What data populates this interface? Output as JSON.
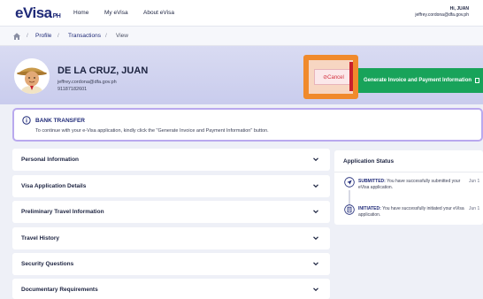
{
  "header": {
    "logo": "eVisa",
    "logo_suffix": "PH",
    "nav": [
      "Home",
      "My eVisa",
      "About eVisa"
    ],
    "greeting": "Hi, JUAN",
    "email": "jeffrey.cordona@dfa.gov.ph"
  },
  "breadcrumb": {
    "items": [
      "Profile",
      "Transactions",
      "View"
    ],
    "separator": "/"
  },
  "profile": {
    "name": "DE LA CRUZ, JUAN",
    "email": "jeffrey.cordona@dfa.gov.ph",
    "phone": "91187182601"
  },
  "actions": {
    "cancel_label": "⊘Cancel",
    "generate_label": "Generate Invoice and Payment Information"
  },
  "alert": {
    "title": "BANK TRANSFER",
    "text": "To continue with your e-Visa application, kindly click the \"Generate Invoice and Payment Information\" button."
  },
  "sections": [
    "Personal Information",
    "Visa Application Details",
    "Preliminary Travel Information",
    "Travel History",
    "Security Questions",
    "Documentary Requirements"
  ],
  "application_status": {
    "title": "Application Status",
    "events": [
      {
        "keyword": "SUBMITTED:",
        "text": "You have successfully submitted your eVisa application.",
        "date": "Jun 1",
        "icon": "send-icon"
      },
      {
        "keyword": "INITIATED:",
        "text": "You have successfully initiated your eVisa application.",
        "date": "Jun 1",
        "icon": "document-icon"
      }
    ]
  },
  "colors": {
    "brand": "#1f2a78",
    "accent_purple": "#b9a9ee",
    "generate_green": "#18a35a",
    "cancel_red": "#d32f3c",
    "highlight_orange": "#f08a2c"
  }
}
